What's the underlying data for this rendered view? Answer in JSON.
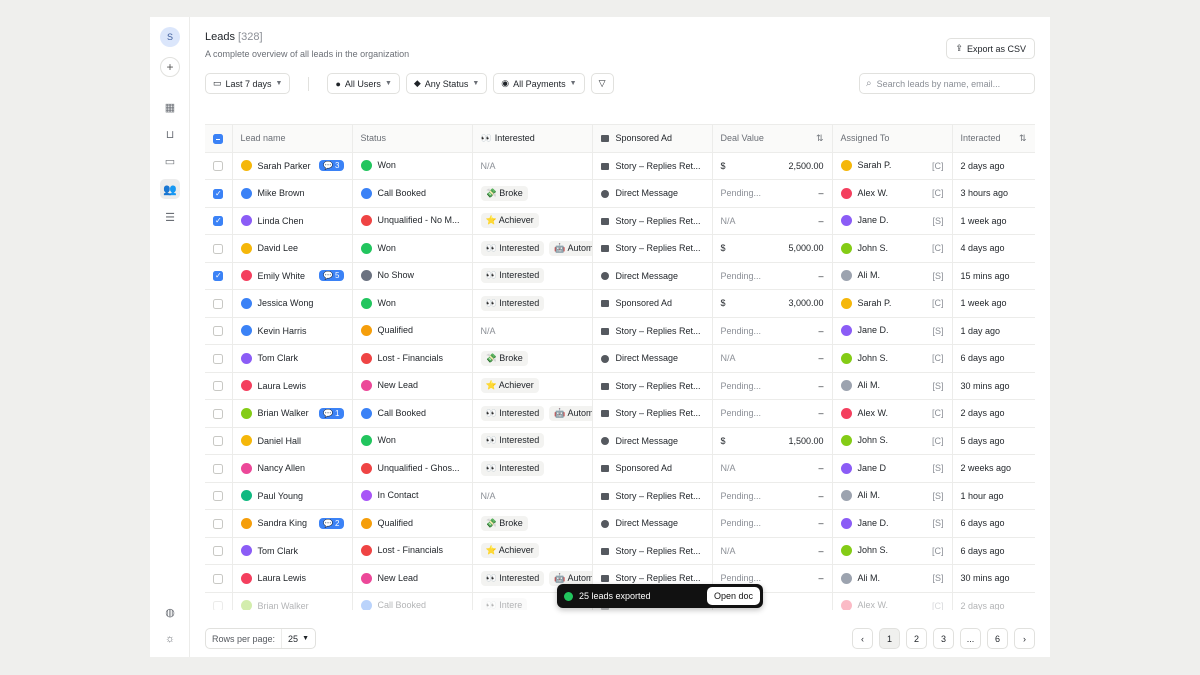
{
  "rail": {
    "avatar": "S"
  },
  "header": {
    "title": "Leads",
    "count": "[328]",
    "subtitle": "A complete overview of all leads in the organization",
    "export": "Export as CSV"
  },
  "filters": {
    "date": "Last 7 days",
    "users": "All Users",
    "status": "Any Status",
    "payments": "All Payments"
  },
  "search": {
    "placeholder": "Search leads by name, email..."
  },
  "columns": {
    "name": "Lead name",
    "status": "Status",
    "interested": "Interested",
    "source": "Sponsored Ad",
    "deal": "Deal Value",
    "assigned": "Assigned To",
    "interacted": "Interacted"
  },
  "colors": {
    "accent": "#3b82f6",
    "won": "#22c55e",
    "lost": "#ef4444"
  },
  "rows": [
    {
      "checked": false,
      "color": "#f5b70a",
      "name": "Sarah Parker",
      "badge": "3",
      "status": "Won",
      "sicon": "#22c55e",
      "tags": [],
      "interest_na": "N/A",
      "src": "Story – Replies Ret...",
      "srcType": "story",
      "cur": "$",
      "amount": "2,500.00",
      "acolor": "#f5b70a",
      "assignee": "Sarah P.",
      "role": "[C]",
      "time": "2 days ago"
    },
    {
      "checked": true,
      "color": "#3b82f6",
      "name": "Mike Brown",
      "badge": "",
      "status": "Call Booked",
      "sicon": "#3b82f6",
      "tags": [
        "💸 Broke"
      ],
      "interest_na": "",
      "src": "Direct Message",
      "srcType": "msg",
      "cur": "Pending...",
      "amount": "–",
      "acolor": "#f43f5e",
      "assignee": "Alex W.",
      "role": "[C]",
      "time": "3 hours ago"
    },
    {
      "checked": true,
      "color": "#8b5cf6",
      "name": "Linda Chen",
      "badge": "",
      "status": "Unqualified - No M...",
      "sicon": "#ef4444",
      "tags": [
        "⭐ Achiever"
      ],
      "interest_na": "",
      "src": "Story – Replies Ret...",
      "srcType": "story",
      "cur": "N/A",
      "amount": "–",
      "acolor": "#8b5cf6",
      "assignee": "Jane D.",
      "role": "[S]",
      "time": "1 week ago"
    },
    {
      "checked": false,
      "color": "#f5b70a",
      "name": "David Lee",
      "badge": "",
      "status": "Won",
      "sicon": "#22c55e",
      "tags": [
        "👀 Interested",
        "🤖 Autom"
      ],
      "interest_na": "",
      "src": "Story – Replies Ret...",
      "srcType": "story",
      "cur": "$",
      "amount": "5,000.00",
      "acolor": "#84cc16",
      "assignee": "John S.",
      "role": "[C]",
      "time": "4 days ago"
    },
    {
      "checked": true,
      "color": "#f43f5e",
      "name": "Emily White",
      "badge": "5",
      "status": "No Show",
      "sicon": "#6b7280",
      "tags": [
        "👀 Interested"
      ],
      "interest_na": "",
      "src": "Direct Message",
      "srcType": "msg",
      "cur": "Pending...",
      "amount": "–",
      "acolor": "#9ca3af",
      "assignee": "Ali M.",
      "role": "[S]",
      "time": "15 mins ago"
    },
    {
      "checked": false,
      "color": "#3b82f6",
      "name": "Jessica Wong",
      "badge": "",
      "status": "Won",
      "sicon": "#22c55e",
      "tags": [
        "👀 Interested"
      ],
      "interest_na": "",
      "src": "Sponsored Ad",
      "srcType": "ad",
      "cur": "$",
      "amount": "3,000.00",
      "acolor": "#f5b70a",
      "assignee": "Sarah P.",
      "role": "[C]",
      "time": "1 week ago"
    },
    {
      "checked": false,
      "color": "#3b82f6",
      "name": "Kevin Harris",
      "badge": "",
      "status": "Qualified",
      "sicon": "#f59e0b",
      "tags": [],
      "interest_na": "N/A",
      "src": "Story – Replies Ret...",
      "srcType": "story",
      "cur": "Pending...",
      "amount": "–",
      "acolor": "#8b5cf6",
      "assignee": "Jane D.",
      "role": "[S]",
      "time": "1 day ago"
    },
    {
      "checked": false,
      "color": "#8b5cf6",
      "name": "Tom Clark",
      "badge": "",
      "status": "Lost - Financials",
      "sicon": "#ef4444",
      "tags": [
        "💸 Broke"
      ],
      "interest_na": "",
      "src": "Direct Message",
      "srcType": "msg",
      "cur": "N/A",
      "amount": "–",
      "acolor": "#84cc16",
      "assignee": "John S.",
      "role": "[C]",
      "time": "6 days ago"
    },
    {
      "checked": false,
      "color": "#f43f5e",
      "name": "Laura Lewis",
      "badge": "",
      "status": "New Lead",
      "sicon": "#ec4899",
      "tags": [
        "⭐ Achiever"
      ],
      "interest_na": "",
      "src": "Story – Replies Ret...",
      "srcType": "story",
      "cur": "Pending...",
      "amount": "–",
      "acolor": "#9ca3af",
      "assignee": "Ali M.",
      "role": "[S]",
      "time": "30 mins ago"
    },
    {
      "checked": false,
      "color": "#84cc16",
      "name": "Brian Walker",
      "badge": "1",
      "status": "Call Booked",
      "sicon": "#3b82f6",
      "tags": [
        "👀 Interested",
        "🤖 Autom"
      ],
      "interest_na": "",
      "src": "Story – Replies Ret...",
      "srcType": "story",
      "cur": "Pending...",
      "amount": "–",
      "acolor": "#f43f5e",
      "assignee": "Alex W.",
      "role": "[C]",
      "time": "2 days ago"
    },
    {
      "checked": false,
      "color": "#f5b70a",
      "name": "Daniel Hall",
      "badge": "",
      "status": "Won",
      "sicon": "#22c55e",
      "tags": [
        "👀 Interested"
      ],
      "interest_na": "",
      "src": "Direct Message",
      "srcType": "msg",
      "cur": "$",
      "amount": "1,500.00",
      "acolor": "#84cc16",
      "assignee": "John S.",
      "role": "[C]",
      "time": "5 days ago"
    },
    {
      "checked": false,
      "color": "#ec4899",
      "name": "Nancy Allen",
      "badge": "",
      "status": "Unqualified - Ghos...",
      "sicon": "#ef4444",
      "tags": [
        "👀 Interested"
      ],
      "interest_na": "",
      "src": "Sponsored Ad",
      "srcType": "ad",
      "cur": "N/A",
      "amount": "–",
      "acolor": "#8b5cf6",
      "assignee": "Jane D",
      "role": "[S]",
      "time": "2 weeks ago"
    },
    {
      "checked": false,
      "color": "#10b981",
      "name": "Paul Young",
      "badge": "",
      "status": "In Contact",
      "sicon": "#a855f7",
      "tags": [],
      "interest_na": "N/A",
      "src": "Story – Replies Ret...",
      "srcType": "story",
      "cur": "Pending...",
      "amount": "–",
      "acolor": "#9ca3af",
      "assignee": "Ali M.",
      "role": "[S]",
      "time": "1 hour ago"
    },
    {
      "checked": false,
      "color": "#f59e0b",
      "name": "Sandra King",
      "badge": "2",
      "status": "Qualified",
      "sicon": "#f59e0b",
      "tags": [
        "💸 Broke"
      ],
      "interest_na": "",
      "src": "Direct Message",
      "srcType": "msg",
      "cur": "Pending...",
      "amount": "–",
      "acolor": "#8b5cf6",
      "assignee": "Jane D.",
      "role": "[S]",
      "time": "6 days ago"
    },
    {
      "checked": false,
      "color": "#8b5cf6",
      "name": "Tom Clark",
      "badge": "",
      "status": "Lost - Financials",
      "sicon": "#ef4444",
      "tags": [
        "⭐ Achiever"
      ],
      "interest_na": "",
      "src": "Story – Replies Ret...",
      "srcType": "story",
      "cur": "N/A",
      "amount": "–",
      "acolor": "#84cc16",
      "assignee": "John S.",
      "role": "[C]",
      "time": "6 days ago"
    },
    {
      "checked": false,
      "color": "#f43f5e",
      "name": "Laura Lewis",
      "badge": "",
      "status": "New Lead",
      "sicon": "#ec4899",
      "tags": [
        "👀 Interested",
        "🤖 Autom"
      ],
      "interest_na": "",
      "src": "Story – Replies Ret...",
      "srcType": "story",
      "cur": "Pending...",
      "amount": "–",
      "acolor": "#9ca3af",
      "assignee": "Ali M.",
      "role": "[S]",
      "time": "30 mins ago"
    },
    {
      "checked": false,
      "color": "#84cc16",
      "name": "Brian Walker",
      "badge": "",
      "status": "Call Booked",
      "sicon": "#3b82f6",
      "tags": [
        "👀 Intere"
      ],
      "interest_na": "",
      "src": "",
      "srcType": "story",
      "cur": "",
      "amount": "",
      "acolor": "#f43f5e",
      "assignee": "Alex W.",
      "role": "[C]",
      "time": "2 days ago",
      "faded": true
    }
  ],
  "footer": {
    "rows_label": "Rows per page:",
    "rows_value": "25",
    "pages": [
      "1",
      "2",
      "3",
      "...",
      "6"
    ]
  },
  "toast": {
    "message": "25 leads exported",
    "action": "Open doc"
  }
}
